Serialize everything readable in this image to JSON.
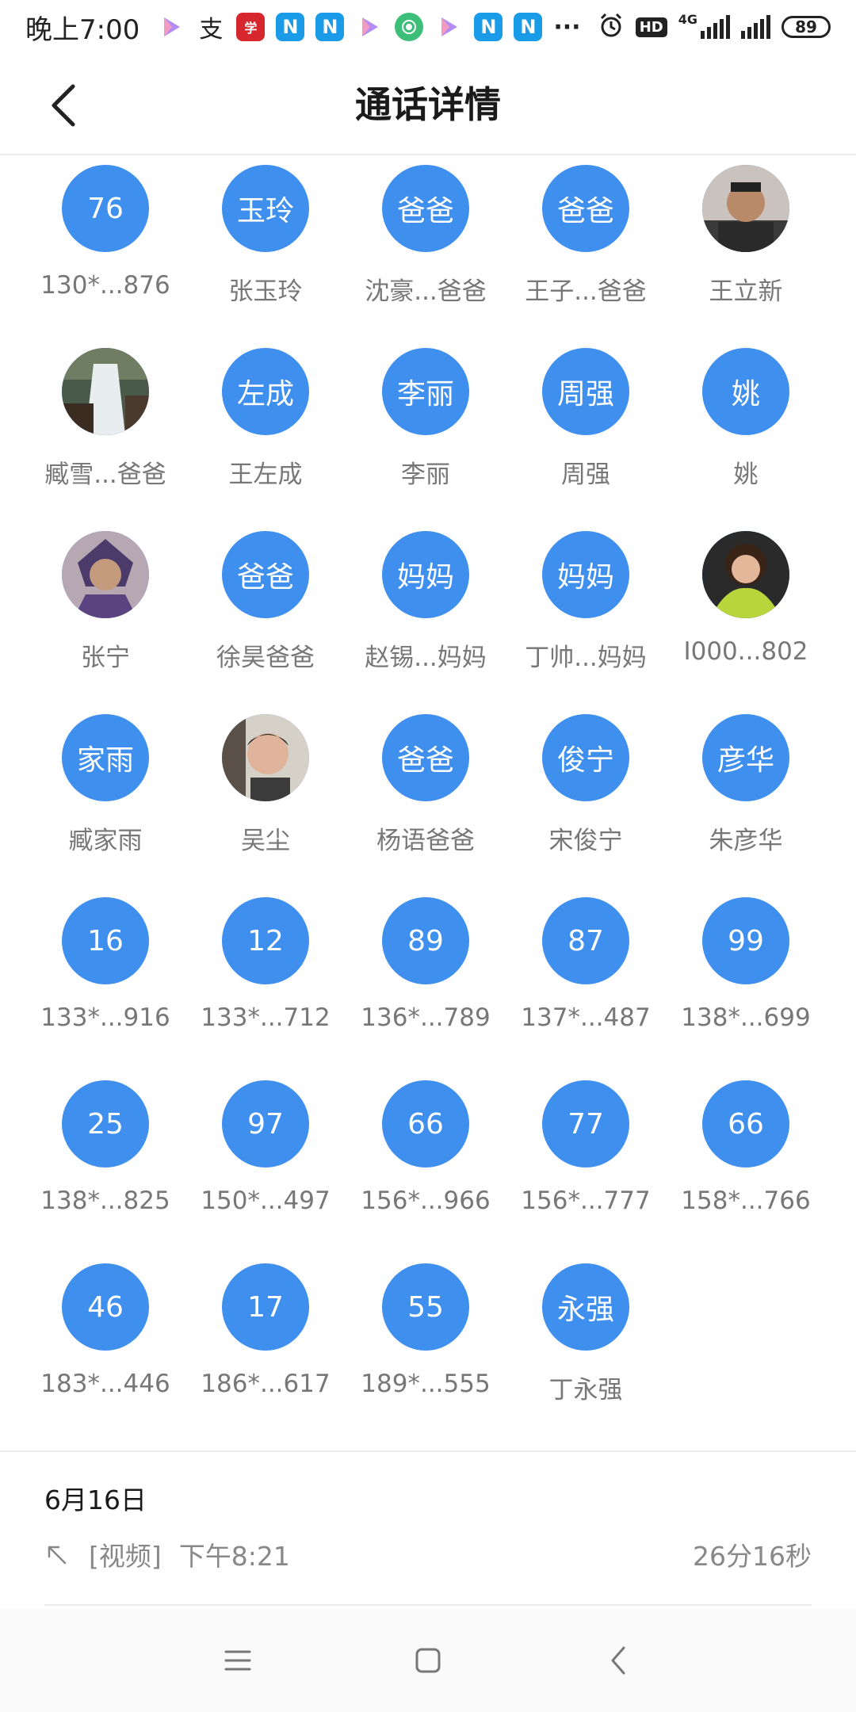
{
  "status": {
    "time": "晚上7:00",
    "battery": "89",
    "hd": "HD",
    "network": "4G",
    "more": "···"
  },
  "header": {
    "title": "通话详情"
  },
  "contacts": [
    {
      "avatar_text": "76",
      "name": "130*...876"
    },
    {
      "avatar_text": "玉玲",
      "name": "张玉玲"
    },
    {
      "avatar_text": "爸爸",
      "name": "沈豪...爸爸"
    },
    {
      "avatar_text": "爸爸",
      "name": "王子...爸爸"
    },
    {
      "avatar_text": "",
      "name": "王立新",
      "photo": "man"
    },
    {
      "avatar_text": "",
      "name": "臧雪...爸爸",
      "photo": "waterfall"
    },
    {
      "avatar_text": "左成",
      "name": "王左成"
    },
    {
      "avatar_text": "李丽",
      "name": "李丽"
    },
    {
      "avatar_text": "周强",
      "name": "周强"
    },
    {
      "avatar_text": "姚",
      "name": "姚"
    },
    {
      "avatar_text": "",
      "name": "张宁",
      "photo": "cartoon"
    },
    {
      "avatar_text": "爸爸",
      "name": "徐昊爸爸"
    },
    {
      "avatar_text": "妈妈",
      "name": "赵锡...妈妈"
    },
    {
      "avatar_text": "妈妈",
      "name": "丁帅...妈妈"
    },
    {
      "avatar_text": "",
      "name": "I000...802",
      "photo": "woman"
    },
    {
      "avatar_text": "家雨",
      "name": "臧家雨"
    },
    {
      "avatar_text": "",
      "name": "吴尘",
      "photo": "selfie"
    },
    {
      "avatar_text": "爸爸",
      "name": "杨语爸爸"
    },
    {
      "avatar_text": "俊宁",
      "name": "宋俊宁"
    },
    {
      "avatar_text": "彦华",
      "name": "朱彦华"
    },
    {
      "avatar_text": "16",
      "name": "133*...916"
    },
    {
      "avatar_text": "12",
      "name": "133*...712"
    },
    {
      "avatar_text": "89",
      "name": "136*...789"
    },
    {
      "avatar_text": "87",
      "name": "137*...487"
    },
    {
      "avatar_text": "99",
      "name": "138*...699"
    },
    {
      "avatar_text": "25",
      "name": "138*...825"
    },
    {
      "avatar_text": "97",
      "name": "150*...497"
    },
    {
      "avatar_text": "66",
      "name": "156*...966"
    },
    {
      "avatar_text": "77",
      "name": "156*...777"
    },
    {
      "avatar_text": "66",
      "name": "158*...766"
    },
    {
      "avatar_text": "46",
      "name": "183*...446"
    },
    {
      "avatar_text": "17",
      "name": "186*...617"
    },
    {
      "avatar_text": "55",
      "name": "189*...555"
    },
    {
      "avatar_text": "永强",
      "name": "丁永强"
    }
  ],
  "call": {
    "date": "6月16日",
    "type": "[视频]",
    "time": "下午8:21",
    "duration": "26分16秒"
  },
  "colors": {
    "avatar_blue": "#3f8fee"
  }
}
